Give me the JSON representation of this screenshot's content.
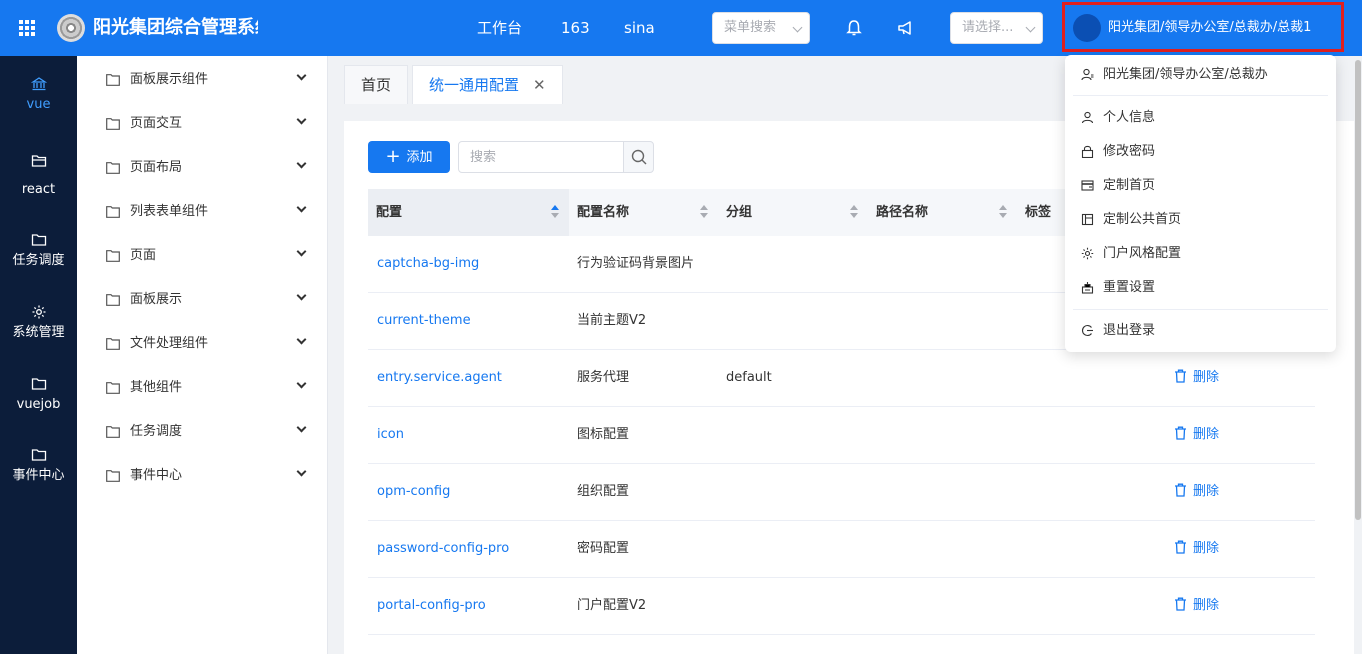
{
  "header": {
    "app_title": "阳光集团综合管理系统",
    "nav": [
      "工作台",
      "163",
      "sina"
    ],
    "menu_search_placeholder": "菜单搜索",
    "org_select_placeholder": "请选择...",
    "user_label": "阳光集团/领导办公室/总裁办/总裁1"
  },
  "rail": {
    "items": [
      {
        "label": "vue",
        "icon": "bank-icon",
        "active": true
      },
      {
        "label": "react",
        "icon": "folder-open-icon"
      },
      {
        "label": "任务调度",
        "icon": "folder-icon"
      },
      {
        "label": "系统管理",
        "icon": "gear-icon"
      },
      {
        "label": "vuejob",
        "icon": "folder-icon"
      },
      {
        "label": "事件中心",
        "icon": "folder-icon"
      }
    ]
  },
  "tree": {
    "items": [
      "面板展示组件",
      "页面交互",
      "页面布局",
      "列表表单组件",
      "页面",
      "面板展示",
      "文件处理组件",
      "其他组件",
      "任务调度",
      "事件中心"
    ]
  },
  "tabs": [
    {
      "label": "首页"
    },
    {
      "label": "统一通用配置",
      "active": true
    }
  ],
  "toolbar": {
    "add_label": "添加",
    "search_placeholder": "搜索"
  },
  "table": {
    "columns": [
      "配置",
      "配置名称",
      "分组",
      "路径名称",
      "标签"
    ],
    "delete_label": "删除",
    "rows": [
      {
        "key": "captcha-bg-img",
        "name": "行为验证码背景图片",
        "group": ""
      },
      {
        "key": "current-theme",
        "name": "当前主题V2",
        "group": ""
      },
      {
        "key": "entry.service.agent",
        "name": "服务代理",
        "group": "default"
      },
      {
        "key": "icon",
        "name": "图标配置",
        "group": ""
      },
      {
        "key": "opm-config",
        "name": "组织配置",
        "group": ""
      },
      {
        "key": "password-config-pro",
        "name": "密码配置",
        "group": ""
      },
      {
        "key": "portal-config-pro",
        "name": "门户配置V2",
        "group": ""
      }
    ]
  },
  "dropdown": {
    "current_org": "阳光集团/领导办公室/总裁办",
    "items": [
      "个人信息",
      "修改密码",
      "定制首页",
      "定制公共首页",
      "门户风格配置",
      "重置设置"
    ],
    "logout": "退出登录"
  },
  "colors": {
    "primary": "#1678f0",
    "rail_bg": "#0c1d3a",
    "highlight_border": "#e02020"
  }
}
